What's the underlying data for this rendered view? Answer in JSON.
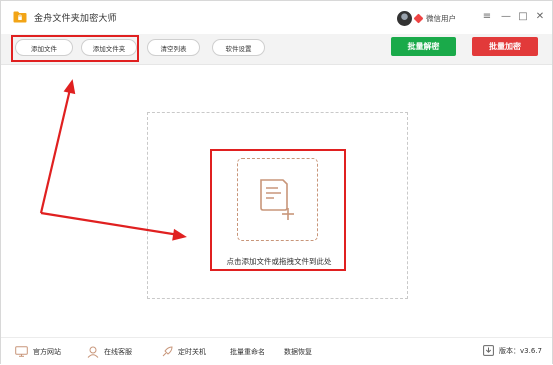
{
  "app": {
    "title": "金舟文件夹加密大师",
    "user_name": "微信用户"
  },
  "window_controls": {
    "menu": "≡",
    "minimize": "—",
    "maximize": "□",
    "close": "✕"
  },
  "toolbar": {
    "add_file": "添加文件",
    "add_folder": "添加文件夹",
    "clear_list": "清空列表",
    "settings": "软件设置",
    "batch_decrypt": "批量解密",
    "batch_encrypt": "批量加密"
  },
  "dropzone": {
    "hint": "点击添加文件或拖拽文件到此处"
  },
  "statusbar": {
    "website": "官方网站",
    "online_service": "在线客服",
    "scheduled_shutdown": "定时关机",
    "batch_rename": "批量重命名",
    "data_recovery": "数据恢复",
    "version": "版本：v3.6.7"
  },
  "colors": {
    "decrypt": "#1aaa4a",
    "encrypt": "#e23a3a",
    "annotation": "#e02020"
  }
}
